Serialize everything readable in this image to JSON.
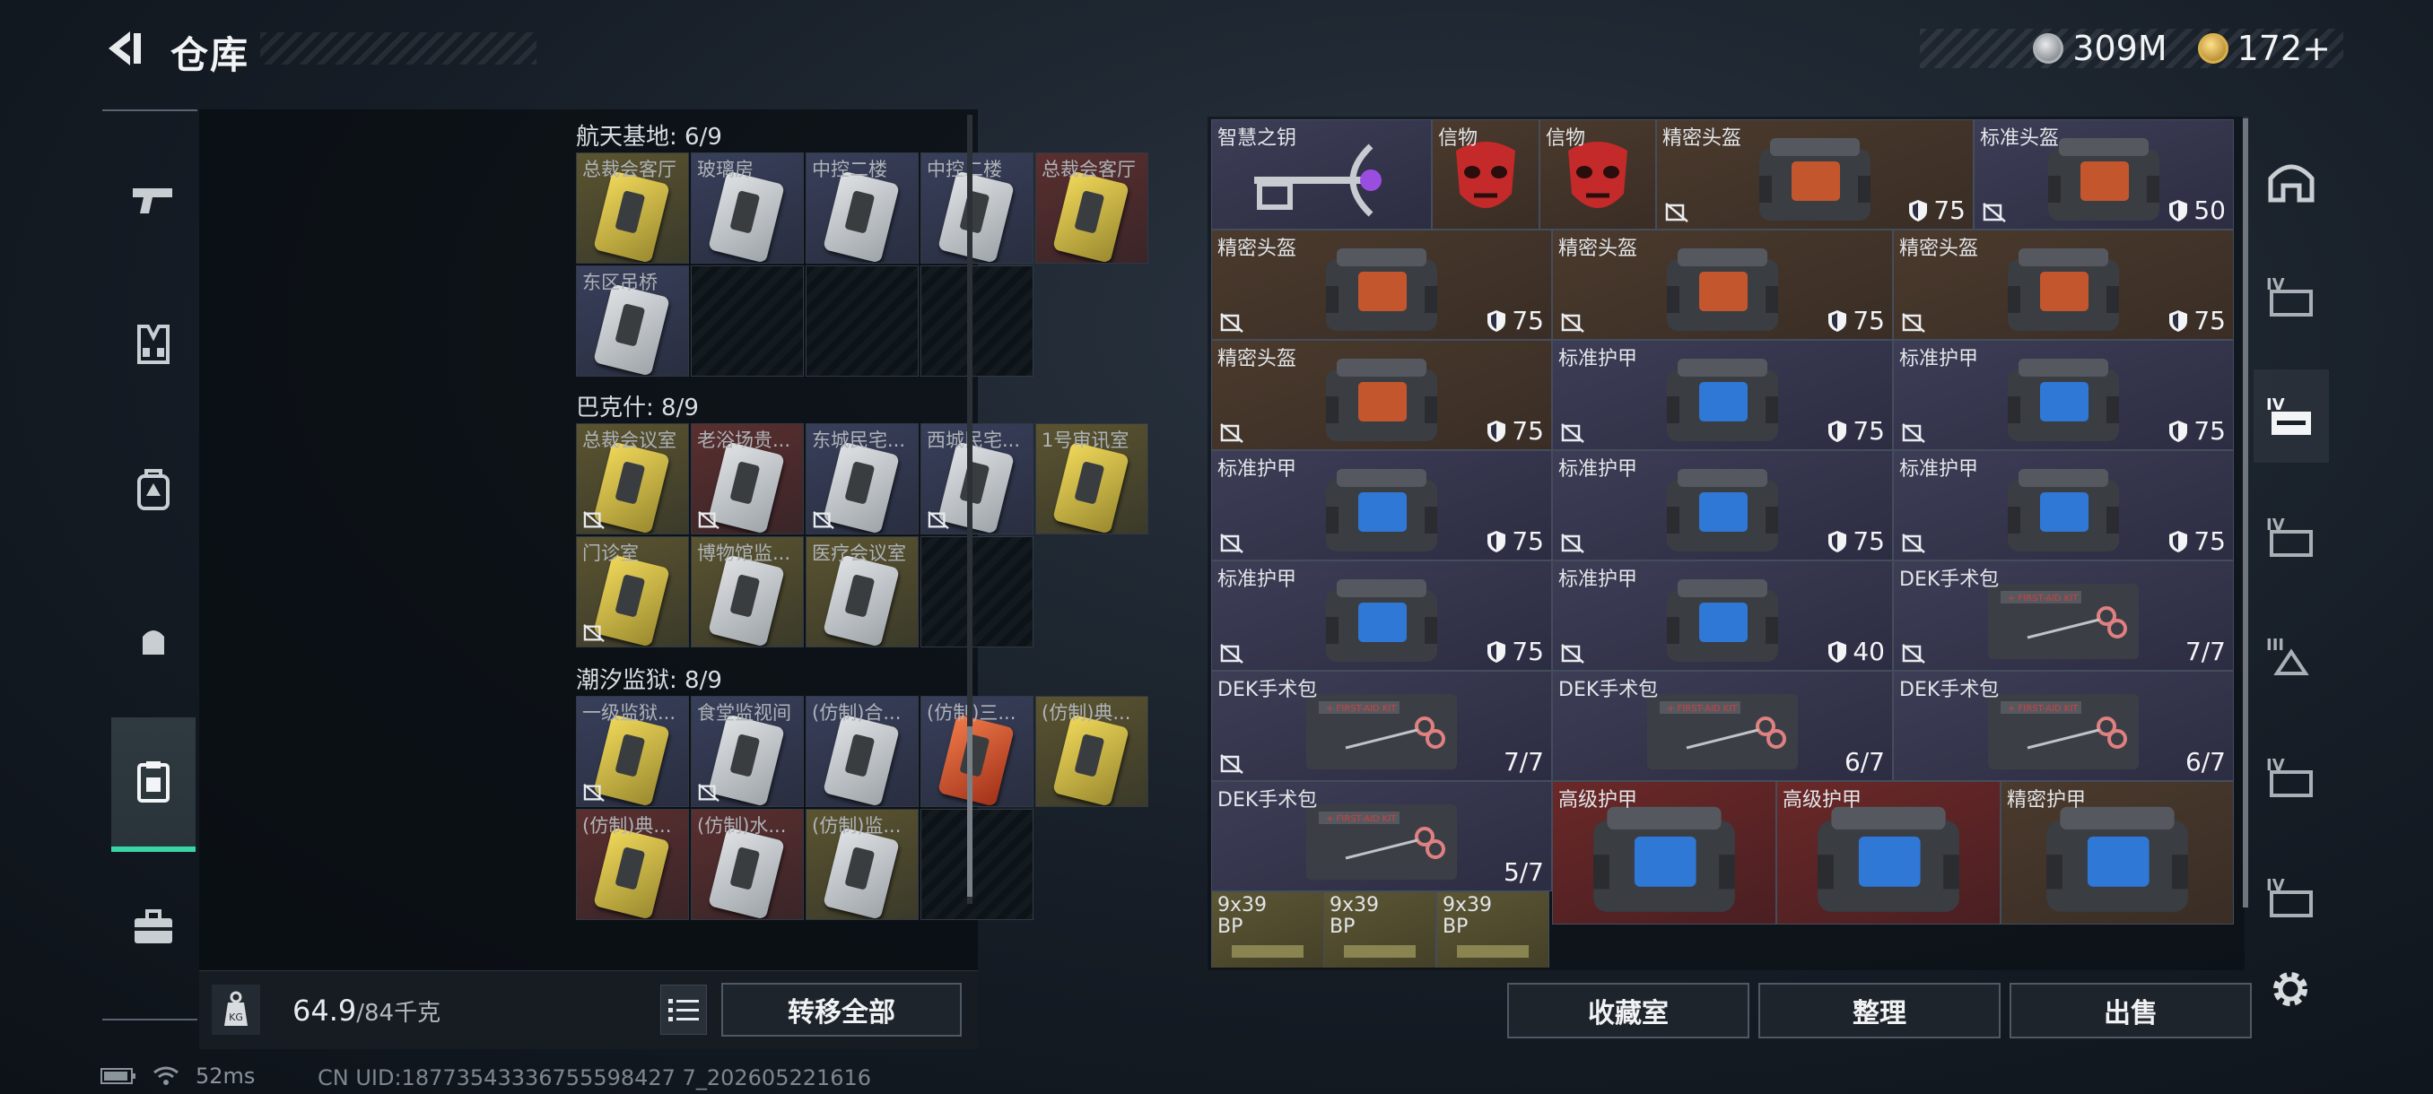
{
  "header": {
    "title": "仓库"
  },
  "currency": [
    {
      "icon": "silver-coin-icon",
      "value": "309M"
    },
    {
      "icon": "gold-coin-icon",
      "value": "172+"
    }
  ],
  "left_nav": [
    {
      "icon": "pistol-icon"
    },
    {
      "icon": "vest-icon"
    },
    {
      "icon": "backpack-icon"
    },
    {
      "icon": "helmet-backpack-icon"
    },
    {
      "icon": "keycard-case-icon",
      "active": true
    },
    {
      "icon": "medical-kit-icon"
    }
  ],
  "key_sections": [
    {
      "name": "航天基地: 6/9",
      "cells": [
        {
          "label": "总裁会客厅",
          "color": "yel",
          "card": "y"
        },
        {
          "label": "玻璃房",
          "color": "blu",
          "card": "w"
        },
        {
          "label": "中控二楼",
          "color": "blu",
          "card": "w"
        },
        {
          "label": "中控二楼",
          "color": "blu",
          "card": "w"
        },
        {
          "label": "总裁会客厅",
          "color": "red",
          "card": "y"
        },
        {
          "label": "东区吊桥",
          "color": "blu",
          "card": "w"
        },
        {
          "label": "",
          "color": "emp"
        },
        {
          "label": "",
          "color": "emp"
        },
        {
          "label": "",
          "color": "emp"
        }
      ]
    },
    {
      "name": "巴克什: 8/9",
      "cells": [
        {
          "label": "总裁会议室",
          "color": "yel",
          "card": "y",
          "flag": true
        },
        {
          "label": "老浴场贵...",
          "color": "red",
          "card": "w",
          "flag": true
        },
        {
          "label": "东城民宅...",
          "color": "blu",
          "card": "w",
          "flag": true
        },
        {
          "label": "西城民宅...",
          "color": "blu",
          "card": "w",
          "flag": true
        },
        {
          "label": "1号审讯室",
          "color": "yel",
          "card": "y"
        },
        {
          "label": "门诊室",
          "color": "yel",
          "card": "y",
          "flag": true
        },
        {
          "label": "博物馆监...",
          "color": "yel",
          "card": "w"
        },
        {
          "label": "医疗会议室",
          "color": "yel",
          "card": "w"
        },
        {
          "label": "",
          "color": "emp"
        }
      ]
    },
    {
      "name": "潮汐监狱: 8/9",
      "cells": [
        {
          "label": "一级监狱...",
          "color": "blu",
          "card": "y",
          "flag": true
        },
        {
          "label": "食堂监视间",
          "color": "blu",
          "card": "w",
          "flag": true
        },
        {
          "label": "(仿制)合...",
          "color": "blu",
          "card": "w"
        },
        {
          "label": "(仿制)三...",
          "color": "blu",
          "card": "r"
        },
        {
          "label": "(仿制)典...",
          "color": "yel",
          "card": "y"
        },
        {
          "label": "(仿制)典...",
          "color": "red",
          "card": "y"
        },
        {
          "label": "(仿制)水...",
          "color": "red",
          "card": "w"
        },
        {
          "label": "(仿制)监...",
          "color": "yel",
          "card": "w"
        },
        {
          "label": "",
          "color": "emp"
        }
      ]
    }
  ],
  "weight": {
    "current": "64.9",
    "max": "/84千克"
  },
  "buttons": {
    "transfer_all": "转移全部",
    "collection": "收藏室",
    "organize": "整理",
    "sell": "出售"
  },
  "stash_items": [
    {
      "name": "智慧之钥",
      "type": "key",
      "color": "purple"
    },
    {
      "name": "信物",
      "type": "mask",
      "color": "brown"
    },
    {
      "name": "信物",
      "type": "mask",
      "color": "brown"
    },
    {
      "name": "精密头盔",
      "type": "helmet",
      "color": "brown",
      "value": "75",
      "flag": true
    },
    {
      "name": "标准头盔",
      "type": "helmet",
      "color": "purple",
      "value": "50",
      "flag": true
    },
    {
      "name": "精密头盔",
      "type": "helmet",
      "color": "brown",
      "value": "75",
      "flag": true
    },
    {
      "name": "精密头盔",
      "type": "helmet",
      "color": "brown",
      "value": "75",
      "flag": true
    },
    {
      "name": "精密头盔",
      "type": "helmet",
      "color": "brown",
      "value": "75",
      "flag": true
    },
    {
      "name": "精密头盔",
      "type": "helmet",
      "color": "brown",
      "value": "75",
      "flag": true
    },
    {
      "name": "标准护甲",
      "type": "armor",
      "color": "purple",
      "value": "75",
      "flag": true
    },
    {
      "name": "标准护甲",
      "type": "armor",
      "color": "purple",
      "value": "75",
      "flag": true
    },
    {
      "name": "标准护甲",
      "type": "armor",
      "color": "purple",
      "value": "75",
      "flag": true
    },
    {
      "name": "标准护甲",
      "type": "armor",
      "color": "purple",
      "value": "75",
      "flag": true
    },
    {
      "name": "标准护甲",
      "type": "armor",
      "color": "purple",
      "value": "75",
      "flag": true
    },
    {
      "name": "标准护甲",
      "type": "armor",
      "color": "purple",
      "value": "75",
      "flag": true
    },
    {
      "name": "标准护甲",
      "type": "armor",
      "color": "purple",
      "value": "40",
      "flag": true
    },
    {
      "name": "DEK手术包",
      "type": "medkit",
      "color": "purple",
      "value": "7/7",
      "flag": true
    },
    {
      "name": "DEK手术包",
      "type": "medkit",
      "color": "purple",
      "value": "7/7",
      "flag": true
    },
    {
      "name": "DEK手术包",
      "type": "medkit",
      "color": "purple",
      "value": "6/7",
      "flag": false
    },
    {
      "name": "DEK手术包",
      "type": "medkit",
      "color": "purple",
      "value": "6/7",
      "flag": false
    },
    {
      "name": "DEK手术包",
      "type": "medkit",
      "color": "purple",
      "value": "5/7",
      "flag": false
    },
    {
      "name": "高级护甲",
      "type": "bigarmor",
      "color": "red"
    },
    {
      "name": "高级护甲",
      "type": "bigarmor",
      "color": "red"
    },
    {
      "name": "精密护甲",
      "type": "bigarmor",
      "color": "brown"
    },
    {
      "name": "9x39",
      "sub": "BP",
      "type": "ammo",
      "color": "olive"
    },
    {
      "name": "9x39",
      "sub": "BP",
      "type": "ammo",
      "color": "olive"
    },
    {
      "name": "9x39",
      "sub": "BP",
      "type": "ammo",
      "color": "olive"
    }
  ],
  "right_nav": [
    {
      "icon": "helmet-filter-icon"
    },
    {
      "icon": "iv-weapon-case-icon",
      "tier": "IV"
    },
    {
      "icon": "iv-weapon-case-active-icon",
      "tier": "IV",
      "active": true
    },
    {
      "icon": "iv-case-icon",
      "tier": "IV"
    },
    {
      "icon": "iii-case-icon",
      "tier": "III"
    },
    {
      "icon": "iv-case-icon",
      "tier": "IV"
    },
    {
      "icon": "iv-case-icon",
      "tier": "IV"
    }
  ],
  "status": {
    "ping": "52ms",
    "uid": "CN UID:18773543336755598427 7_202605221616"
  }
}
